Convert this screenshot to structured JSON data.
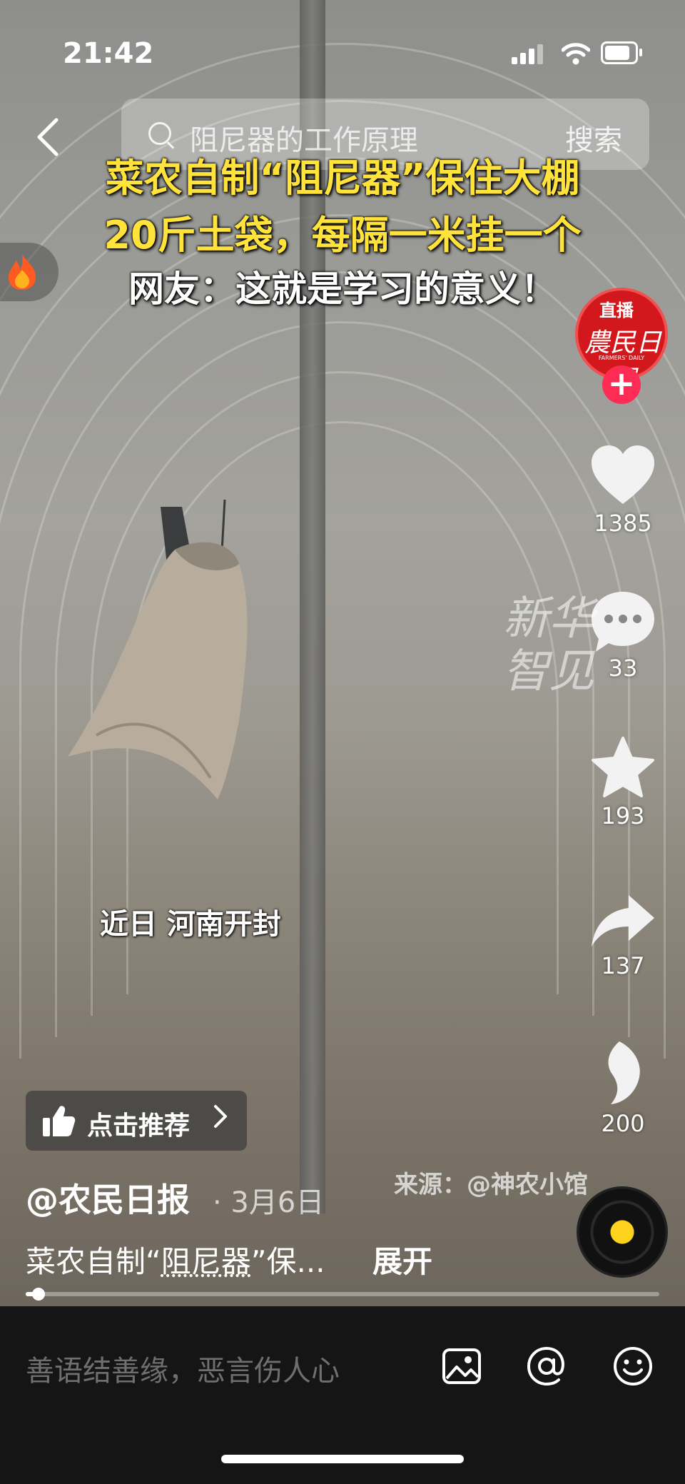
{
  "status_bar": {
    "time": "21:42"
  },
  "search": {
    "query": "阻尼器的工作原理",
    "button": "搜索"
  },
  "captions": {
    "line1": "菜农自制“阻尼器”保住大棚",
    "line2": "20斤土袋，每隔一米挂一个",
    "line3": "网友：这就是学习的意义！"
  },
  "video_overlay": {
    "location": "近日 河南开封",
    "watermark": "新华智见",
    "source": "来源：@神农小馆"
  },
  "creator": {
    "live_badge": "直播",
    "logo_text": "農民日報",
    "logo_sub": "FARMERS' DAILY",
    "follow": "+"
  },
  "actions": {
    "likes": "1385",
    "comments": "33",
    "favorites": "193",
    "shares": "137",
    "extra": "200"
  },
  "recommend": {
    "label": "点击推荐"
  },
  "post": {
    "author": "@农民日报",
    "date": "· 3月6日",
    "desc_prefix": "菜农自制“",
    "desc_keyword": "阻尼器",
    "desc_suffix": "”保...",
    "expand": "展开"
  },
  "progress": {
    "fraction": 0.015
  },
  "comment_bar": {
    "placeholder": "善语结善缘，恶言伤人心"
  },
  "icons": [
    "back-icon",
    "search-icon",
    "fire-icon",
    "heart-icon",
    "comment-icon",
    "star-icon",
    "share-icon",
    "swipe-icon",
    "thumb-up-icon",
    "chevron-right-icon",
    "image-icon",
    "at-icon",
    "emoji-icon"
  ]
}
